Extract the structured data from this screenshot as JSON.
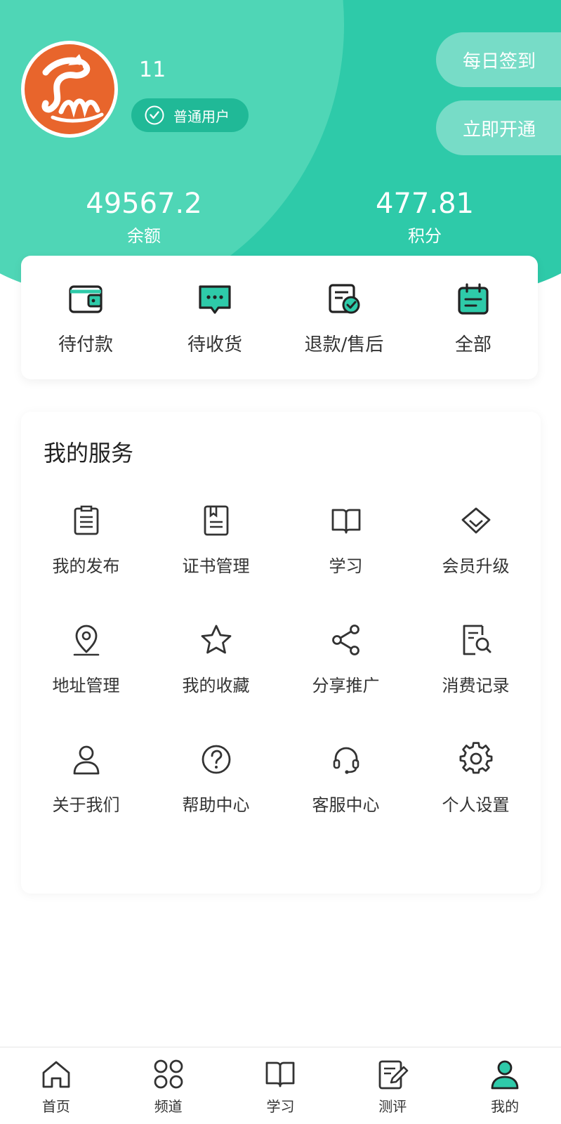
{
  "colors": {
    "primary": "#2ecaa9",
    "primary_light": "#4fd6b6",
    "avatar_bg": "#e8652c"
  },
  "user": {
    "name": "11",
    "level": "普通用户"
  },
  "actions": {
    "checkin": "每日签到",
    "open": "立即开通"
  },
  "stats": {
    "balance": {
      "value": "49567.2",
      "label": "余额"
    },
    "points": {
      "value": "477.81",
      "label": "积分"
    }
  },
  "orders": [
    {
      "label": "待付款",
      "icon": "wallet-icon"
    },
    {
      "label": "待收货",
      "icon": "message-icon"
    },
    {
      "label": "退款/售后",
      "icon": "refund-icon"
    },
    {
      "label": "全部",
      "icon": "calendar-icon"
    }
  ],
  "services": {
    "title": "我的服务",
    "items": [
      {
        "label": "我的发布",
        "icon": "clipboard-icon"
      },
      {
        "label": "证书管理",
        "icon": "certificate-icon"
      },
      {
        "label": "学习",
        "icon": "book-icon"
      },
      {
        "label": "会员升级",
        "icon": "diamond-icon"
      },
      {
        "label": "地址管理",
        "icon": "location-icon"
      },
      {
        "label": "我的收藏",
        "icon": "star-icon"
      },
      {
        "label": "分享推广",
        "icon": "share-icon"
      },
      {
        "label": "消费记录",
        "icon": "record-search-icon"
      },
      {
        "label": "关于我们",
        "icon": "person-icon"
      },
      {
        "label": "帮助中心",
        "icon": "help-icon"
      },
      {
        "label": "客服中心",
        "icon": "headset-icon"
      },
      {
        "label": "个人设置",
        "icon": "gear-icon"
      }
    ]
  },
  "tabs": [
    {
      "label": "首页",
      "icon": "home-icon"
    },
    {
      "label": "频道",
      "icon": "grid-icon"
    },
    {
      "label": "学习",
      "icon": "book-icon"
    },
    {
      "label": "测评",
      "icon": "edit-icon"
    },
    {
      "label": "我的",
      "icon": "user-icon",
      "active": true
    }
  ]
}
